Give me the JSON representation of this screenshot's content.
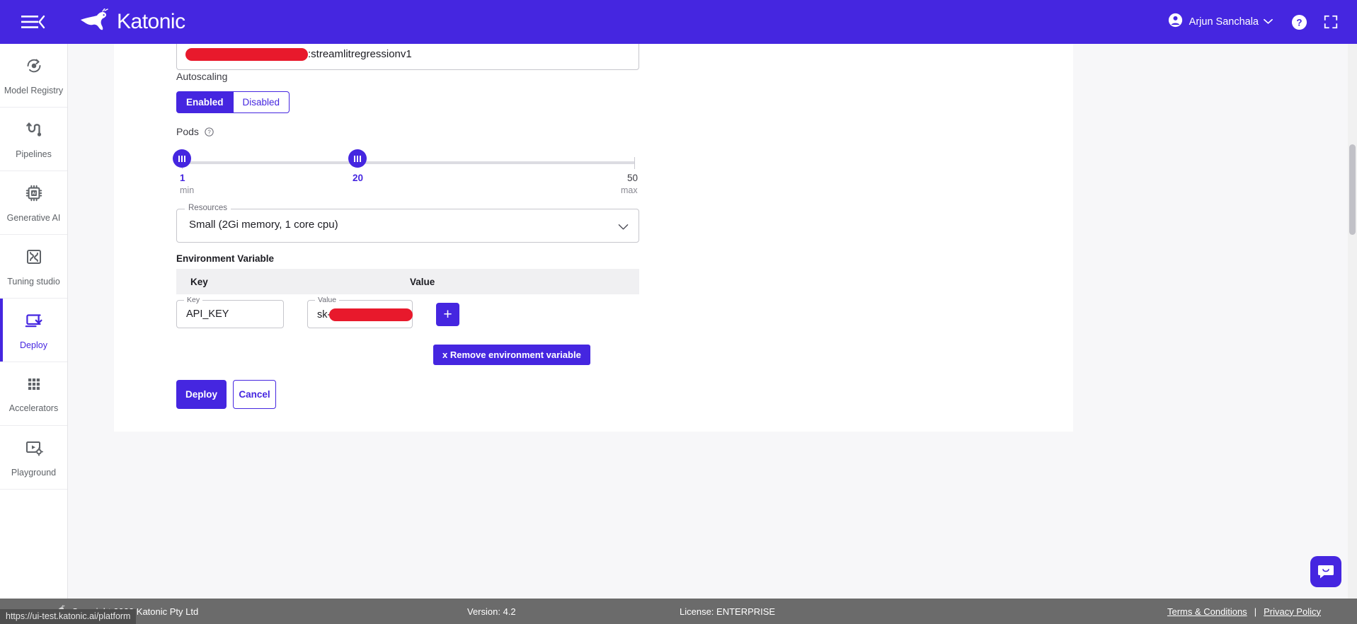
{
  "header": {
    "menu_icon": "hamburger-menu-icon",
    "brand": "Katonic",
    "account_name": "Arjun Sanchala",
    "account_icon": "account-circle-icon",
    "chevron": "chevron-down-icon",
    "help_icon": "help-circle-icon",
    "fullscreen_icon": "fullscreen-expand-icon"
  },
  "sidebar": {
    "items": [
      {
        "label": "Model Registry",
        "icon": "model-registry-icon",
        "active": false
      },
      {
        "label": "Pipelines",
        "icon": "pipelines-icon",
        "active": false
      },
      {
        "label": "Generative AI",
        "icon": "generative-ai-chip-icon",
        "active": false
      },
      {
        "label": "Tuning studio",
        "icon": "tuning-studio-puzzle-icon",
        "active": false
      },
      {
        "label": "Deploy",
        "icon": "deploy-download-icon",
        "active": true
      },
      {
        "label": "Accelerators",
        "icon": "accelerators-grid-icon",
        "active": false
      },
      {
        "label": "Playground",
        "icon": "playground-video-settings-icon",
        "active": false
      }
    ]
  },
  "form": {
    "image_field": {
      "redacted_prefix": true,
      "value": ":streamlitregressionv1"
    },
    "autoscaling": {
      "label": "Autoscaling",
      "enabled_label": "Enabled",
      "disabled_label": "Disabled",
      "selected": "Enabled"
    },
    "pods": {
      "label": "Pods",
      "help_icon": "help-circle-small-icon",
      "min_value": "1",
      "current_value": "20",
      "max_value": "50",
      "min_caption": "min",
      "max_caption": "max",
      "range_min": 1,
      "range_max": 50
    },
    "resources": {
      "legend": "Resources",
      "value": "Small (2Gi memory, 1 core cpu)",
      "chevron": "chevron-down-icon"
    },
    "environment": {
      "section_label": "Environment Variable",
      "columns": [
        "Key",
        "Value"
      ],
      "rows": [
        {
          "key_legend": "Key",
          "key_value": "API_KEY",
          "value_legend": "Value",
          "value_prefix": "sk-",
          "value_redacted": true
        }
      ],
      "add_label": "+",
      "remove_label": "x Remove environment variable"
    },
    "actions": {
      "deploy_label": "Deploy",
      "cancel_label": "Cancel"
    }
  },
  "footer": {
    "copyright": "Copyright 2023 Katonic Pty Ltd",
    "version": "Version: 4.2",
    "license": "License: ENTERPRISE",
    "terms": "Terms & Conditions",
    "separator": "|",
    "privacy": "Privacy Policy"
  },
  "status_bar": {
    "url": "https://ui-test.katonic.ai/platform"
  },
  "chat": {
    "icon": "chat-bubble-icon"
  },
  "colors": {
    "brand_purple": "#4526e0",
    "redaction_red": "#e8192c",
    "footer_gray": "#6b6b6b"
  }
}
